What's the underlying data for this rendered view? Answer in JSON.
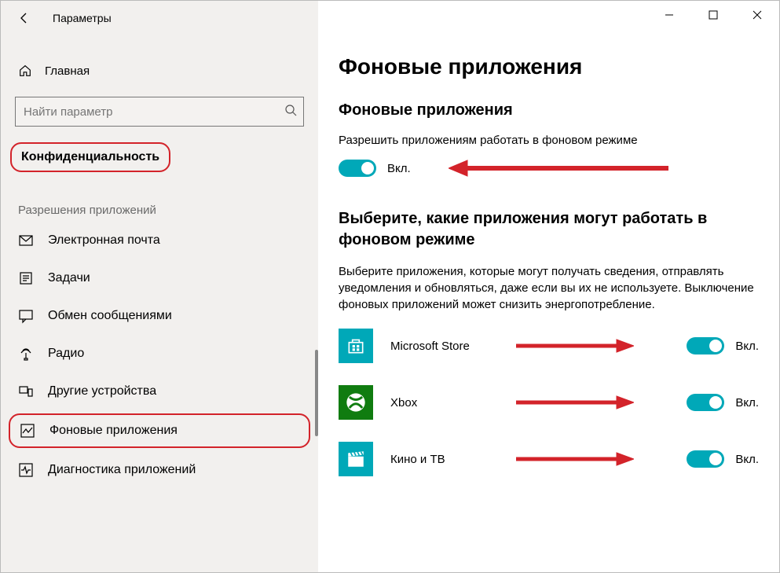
{
  "header": {
    "title": "Параметры"
  },
  "sidebar": {
    "home_label": "Главная",
    "search_placeholder": "Найти параметр",
    "category_label": "Конфиденциальность",
    "section_label": "Разрешения приложений",
    "items": [
      {
        "label": "Электронная почта",
        "icon": "mail-icon"
      },
      {
        "label": "Задачи",
        "icon": "tasks-icon"
      },
      {
        "label": "Обмен сообщениями",
        "icon": "chat-icon"
      },
      {
        "label": "Радио",
        "icon": "radio-icon"
      },
      {
        "label": "Другие устройства",
        "icon": "devices-icon"
      },
      {
        "label": "Фоновые приложения",
        "icon": "background-icon",
        "highlight": true
      },
      {
        "label": "Диагностика приложений",
        "icon": "diagnostics-icon"
      }
    ]
  },
  "main": {
    "page_title": "Фоновые приложения",
    "section1_title": "Фоновые приложения",
    "section1_desc": "Разрешить приложениям работать в фоновом режиме",
    "master_toggle_state": "Вкл.",
    "section2_title": "Выберите, какие приложения могут работать в фоновом режиме",
    "section2_desc": "Выберите приложения, которые могут получать сведения, отправлять уведомления и обновляться, даже если вы их не используете. Выключение фоновых приложений может снизить энергопотребление.",
    "apps": [
      {
        "name": "Microsoft Store",
        "icon": "store-icon",
        "color": "#00a8b8",
        "state": "Вкл."
      },
      {
        "name": "Xbox",
        "icon": "xbox-icon",
        "color": "#107c10",
        "state": "Вкл."
      },
      {
        "name": "Кино и ТВ",
        "icon": "movies-icon",
        "color": "#00a8b8",
        "state": "Вкл."
      }
    ]
  }
}
